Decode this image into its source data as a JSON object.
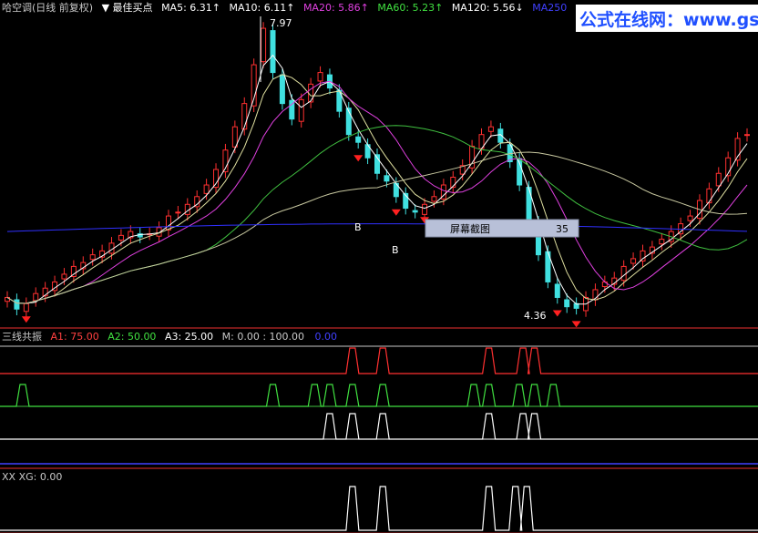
{
  "header": {
    "items": [
      {
        "text": "哈空调(日线 前复权)",
        "color": "#c8c8c8"
      },
      {
        "text": "▼ 最佳买点",
        "color": "#ffffff"
      },
      {
        "text": "MA5: 6.31↑",
        "color": "#ffffff"
      },
      {
        "text": "MA10: 6.11↑",
        "color": "#ffffff"
      },
      {
        "text": "MA20: 5.86↑",
        "color": "#e040e0"
      },
      {
        "text": "MA60: 5.23↑",
        "color": "#40e040"
      },
      {
        "text": "MA120: 5.56↓",
        "color": "#ffffff"
      },
      {
        "text": "MA250",
        "color": "#4040ff"
      }
    ]
  },
  "watermark": {
    "text": "公式在线网：www.gszx.com"
  },
  "tooltip": {
    "label": "屏幕截图",
    "value": "35"
  },
  "indicator1": {
    "items": [
      {
        "text": "三线共振",
        "color": "#c8c8c8"
      },
      {
        "text": "A1: 75.00",
        "color": "#ff4040"
      },
      {
        "text": "A2: 50.00",
        "color": "#40e040"
      },
      {
        "text": "A3: 25.00",
        "color": "#ffffff"
      },
      {
        "text": "M: 0.00 : 100.00",
        "color": "#c8c8c8"
      },
      {
        "text": "0.00",
        "color": "#4040ff"
      }
    ]
  },
  "indicator2": {
    "items": [
      {
        "text": "XX XG: 0.00",
        "color": "#c8c8c8"
      }
    ]
  },
  "chart_data": {
    "type": "candlestick",
    "annotations": [
      {
        "text": "7.97",
        "kind": "high"
      },
      {
        "text": "4.36",
        "kind": "low"
      },
      {
        "text": "B",
        "kind": "buy"
      },
      {
        "text": "B",
        "kind": "buy"
      },
      {
        "text": "B",
        "kind": "buy"
      }
    ],
    "prices": [
      4.5,
      4.35,
      4.42,
      4.55,
      4.62,
      4.7,
      4.8,
      4.9,
      4.95,
      5.05,
      5.1,
      5.2,
      5.3,
      5.35,
      5.28,
      5.32,
      5.4,
      5.55,
      5.6,
      5.7,
      5.8,
      5.95,
      6.15,
      6.4,
      6.7,
      7.0,
      7.5,
      7.97,
      7.4,
      7.0,
      6.8,
      7.05,
      7.25,
      7.4,
      7.2,
      6.9,
      6.6,
      6.5,
      6.3,
      6.1,
      6.0,
      5.8,
      5.65,
      5.6,
      5.7,
      5.8,
      5.95,
      6.05,
      6.2,
      6.45,
      6.6,
      6.7,
      6.5,
      6.25,
      5.95,
      5.5,
      5.05,
      4.7,
      4.5,
      4.38,
      4.36,
      4.5,
      4.6,
      4.7,
      4.75,
      4.9,
      5.0,
      5.1,
      5.15,
      5.25,
      5.35,
      5.45,
      5.55,
      5.75,
      5.9,
      6.1,
      6.3,
      6.55,
      6.6
    ],
    "indicator_levels": {
      "A1": 75.0,
      "A2": 50.0,
      "A3": 25.0,
      "M": 0.0,
      "M_max": 100.0,
      "XG": 0.0
    },
    "signals": {
      "A1": [
        0.465,
        0.505,
        0.645,
        0.69,
        0.705
      ],
      "A2": [
        0.03,
        0.36,
        0.415,
        0.435,
        0.465,
        0.505,
        0.625,
        0.645,
        0.685,
        0.705,
        0.73
      ],
      "A3": [
        0.435,
        0.465,
        0.505,
        0.645,
        0.69,
        0.705
      ],
      "XG": [
        0.465,
        0.505,
        0.645,
        0.68,
        0.695
      ]
    }
  }
}
